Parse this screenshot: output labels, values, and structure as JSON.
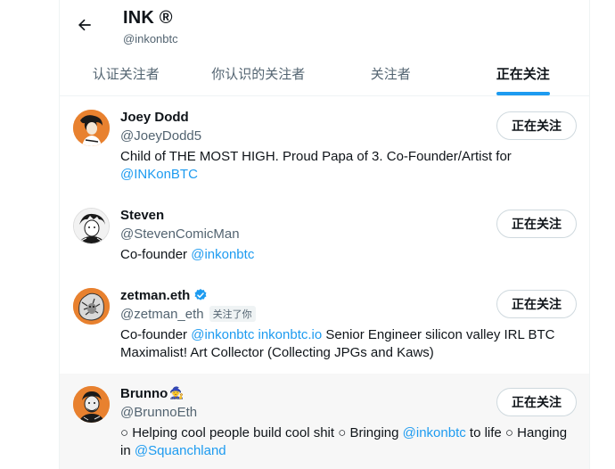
{
  "header": {
    "title": "INK ®",
    "handle": "@inkonbtc",
    "back_icon": "arrow-left-icon"
  },
  "tabs": [
    {
      "label": "认证关注者",
      "active": false
    },
    {
      "label": "你认识的关注者",
      "active": false
    },
    {
      "label": "关注者",
      "active": false
    },
    {
      "label": "正在关注",
      "active": true
    }
  ],
  "colors": {
    "accent": "#1d9bf0",
    "secondary_text": "#536471",
    "avatar_bg": "#e8812f"
  },
  "users": [
    {
      "name": "Joey Dodd",
      "username": "@JoeyDodd5",
      "button": "正在关注",
      "bio": [
        {
          "t": "Child of THE MOST HIGH. Proud Papa of 3. Co-Founder/Artist for "
        },
        {
          "t": "@INKonBTC",
          "link": true
        }
      ]
    },
    {
      "name": "Steven",
      "username": "@StevenComicMan",
      "button": "正在关注",
      "bio": [
        {
          "t": "Co-founder "
        },
        {
          "t": "@inkonbtc",
          "link": true
        }
      ]
    },
    {
      "name": "zetman.eth",
      "verified": true,
      "username": "@zetman_eth",
      "follows_you": "关注了你",
      "button": "正在关注",
      "bio": [
        {
          "t": "Co-founder "
        },
        {
          "t": "@inkonbtc",
          "link": true
        },
        {
          "t": " "
        },
        {
          "t": "inkonbtc.io",
          "link": true
        },
        {
          "t": " Senior Engineer silicon valley IRL BTC Maximalist! Art Collector (Collecting JPGs and Kaws)"
        }
      ]
    },
    {
      "name": "Brunno",
      "emoji": "🧙",
      "username": "@BrunnoEth",
      "button": "正在关注",
      "hovered": true,
      "bio": [
        {
          "t": "○ Helping cool people build cool shit ○ Bringing "
        },
        {
          "t": "@inkonbtc",
          "link": true
        },
        {
          "t": " to life ○ Hanging in "
        },
        {
          "t": "@Squanchland",
          "link": true
        }
      ]
    }
  ]
}
